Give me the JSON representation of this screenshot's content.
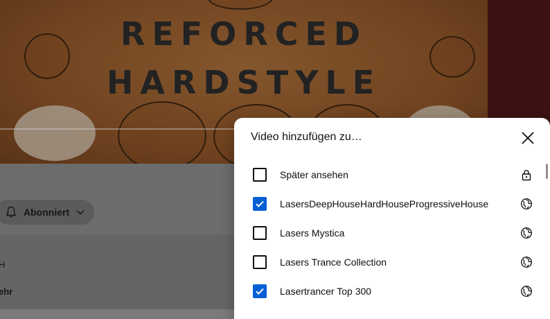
{
  "video": {
    "title_line1": "REFORCED",
    "title_line2": "HARDSTYLE"
  },
  "channel": {
    "subscribe_label": "Abonniert",
    "partial_text_1": "H",
    "partial_text_2": "ehr"
  },
  "dialog": {
    "title": "Video hinzufügen zu…",
    "playlists": [
      {
        "name": "Später ansehen",
        "checked": false,
        "privacy": "lock-icon"
      },
      {
        "name": "LasersDeepHouseHardHouseProgressiveHouse",
        "checked": true,
        "privacy": "globe-icon"
      },
      {
        "name": "Lasers Mystica",
        "checked": false,
        "privacy": "globe-icon"
      },
      {
        "name": "Lasers Trance Collection",
        "checked": false,
        "privacy": "globe-icon"
      },
      {
        "name": "Lasertrancer Top 300",
        "checked": true,
        "privacy": "globe-icon"
      }
    ]
  },
  "colors": {
    "accent": "#065fd4",
    "dialog_bg": "#ffffff",
    "overlay": "#848484"
  }
}
